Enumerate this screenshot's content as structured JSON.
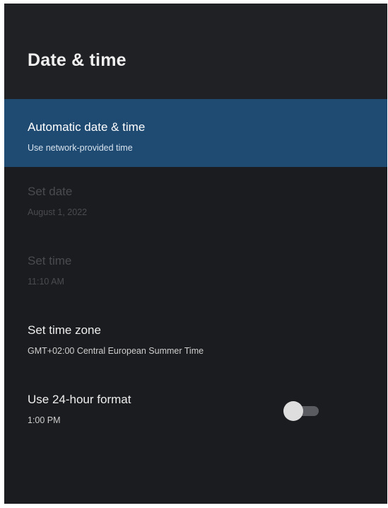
{
  "header": {
    "title": "Date & time"
  },
  "settings": {
    "automatic": {
      "label": "Automatic date & time",
      "value": "Use network-provided time"
    },
    "set_date": {
      "label": "Set date",
      "value": "August 1, 2022"
    },
    "set_time": {
      "label": "Set time",
      "value": "11:10 AM"
    },
    "time_zone": {
      "label": "Set time zone",
      "value": "GMT+02:00 Central European Summer Time"
    },
    "format_24h": {
      "label": "Use 24-hour format",
      "value": "1:00 PM",
      "enabled": false
    }
  },
  "colors": {
    "background": "#1b1c1f",
    "focus_highlight": "#1f4a72",
    "disabled_text": "#4a4b4f"
  }
}
